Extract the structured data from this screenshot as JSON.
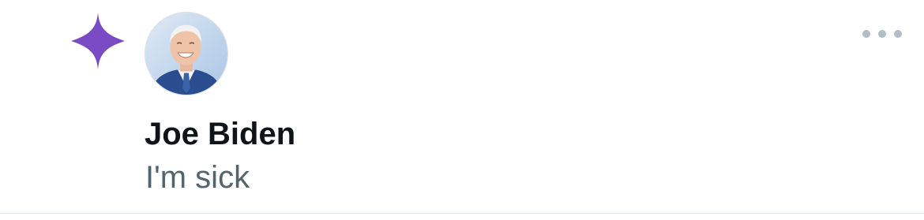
{
  "notification": {
    "author_name": "Joe Biden",
    "message": "I'm sick",
    "icon": "sparkle-icon",
    "more_icon": "more-horizontal-icon",
    "avatar": "profile-photo",
    "colors": {
      "accent": "#794bc4",
      "name_text": "#0f1419",
      "secondary_text": "#536471",
      "more_dots": "#b3bdc6"
    }
  }
}
